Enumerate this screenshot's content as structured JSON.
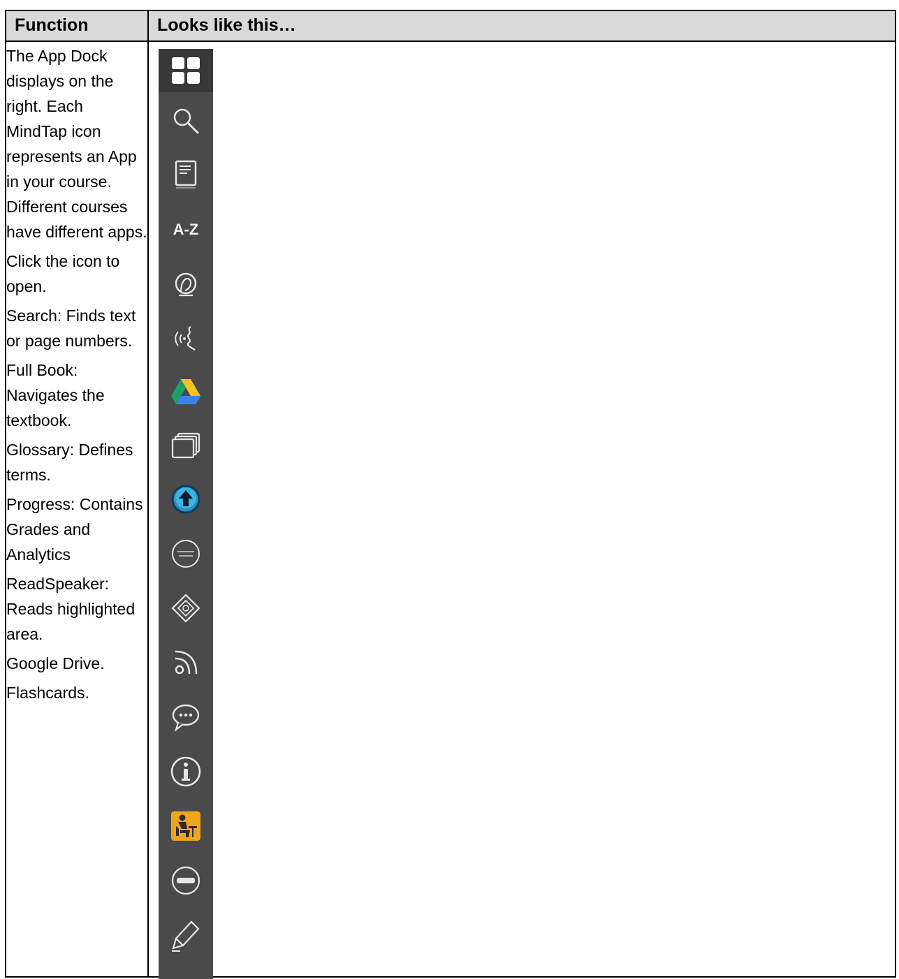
{
  "table": {
    "headers": [
      "Function",
      "Looks like this…"
    ],
    "function_paragraphs": [
      "The App Dock displays on the right.  Each MindTap icon represents an App in your course. Different courses have different apps.",
      "Click the icon to open.",
      "Search: Finds text or page numbers.",
      "Full Book: Navigates the textbook.",
      "Glossary: Defines terms.",
      "Progress: Contains Grades and Analytics",
      "ReadSpeaker: Reads highlighted area.",
      "Google Drive.",
      "Flashcards."
    ]
  },
  "app_dock": {
    "background": "#4a4a4a",
    "icons": [
      {
        "icon": "apps-grid-icon",
        "label": ""
      },
      {
        "icon": "search-icon",
        "label": ""
      },
      {
        "icon": "full-book-icon",
        "label": ""
      },
      {
        "icon": "glossary-icon",
        "label": "A-Z"
      },
      {
        "icon": "progress-icon",
        "label": ""
      },
      {
        "icon": "readspeaker-icon",
        "label": ""
      },
      {
        "icon": "google-drive-icon",
        "label": ""
      },
      {
        "icon": "flashcards-icon",
        "label": ""
      },
      {
        "icon": "upload-icon",
        "label": ""
      },
      {
        "icon": "merriam-webster-icon",
        "label": ""
      },
      {
        "icon": "compass-icon",
        "label": ""
      },
      {
        "icon": "rss-icon",
        "label": ""
      },
      {
        "icon": "chat-icon",
        "label": ""
      },
      {
        "icon": "info-icon",
        "label": ""
      },
      {
        "icon": "learner-icon",
        "label": ""
      },
      {
        "icon": "luvo-icon",
        "label": ""
      },
      {
        "icon": "highlighter-icon",
        "label": ""
      }
    ]
  }
}
